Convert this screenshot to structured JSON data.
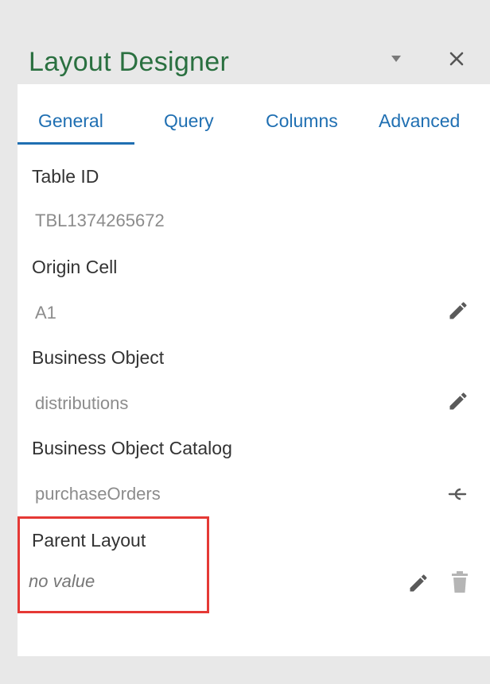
{
  "header": {
    "title": "Layout Designer",
    "dropdown_icon": "chevron-down-icon",
    "close_icon": "close-icon"
  },
  "tabs": [
    {
      "label": "General",
      "selected": true
    },
    {
      "label": "Query",
      "selected": false
    },
    {
      "label": "Columns",
      "selected": false
    },
    {
      "label": "Advanced",
      "selected": false
    }
  ],
  "fields": {
    "table_id": {
      "label": "Table ID",
      "value": "TBL1374265672"
    },
    "origin_cell": {
      "label": "Origin Cell",
      "value": "A1",
      "action_icon": "pencil-icon"
    },
    "business_object": {
      "label": "Business Object",
      "value": "distributions",
      "action_icon": "pencil-icon"
    },
    "business_object_catalog": {
      "label": "Business Object Catalog",
      "value": "purchaseOrders",
      "action_icon": "unlink-icon"
    },
    "parent_layout": {
      "label": "Parent Layout",
      "value": "no value",
      "action_icons": [
        "pencil-icon",
        "trash-icon"
      ]
    }
  },
  "colors": {
    "title": "#2a7040",
    "accent": "#1f6fb2",
    "highlight": "#e53935",
    "background": "#e8e8e8",
    "panel": "#ffffff"
  }
}
